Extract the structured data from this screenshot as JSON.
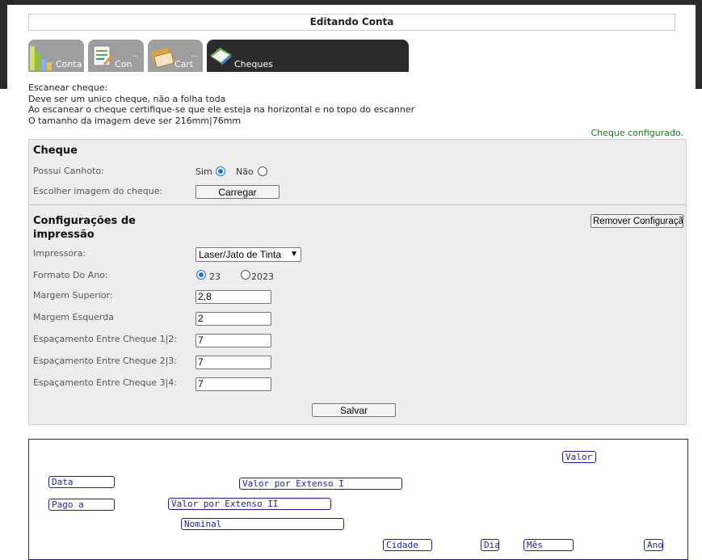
{
  "window": {
    "title": "Editando Conta"
  },
  "tabs": [
    {
      "label": "Conta",
      "more": "",
      "icon": "bar-chart-icon"
    },
    {
      "label": "Con",
      "more": "...",
      "icon": "document-icon"
    },
    {
      "label": "Cart",
      "more": "...",
      "icon": "card-icon"
    },
    {
      "label": "Cheques",
      "more": "",
      "icon": "book-icon",
      "active": true
    }
  ],
  "instructions": [
    "Escanear cheque:",
    "Deve ser um unico cheque, não a folha toda",
    "Ao escanear o cheque certifique-se que ele esteja na horizontal e no topo do escanner",
    "O tamanho da imagem deve ser 216mm|76mm"
  ],
  "status": "Cheque configurado.",
  "cheque": {
    "heading": "Cheque",
    "canhoto_label": "Possui Canhoto:",
    "sim": "Sim",
    "nao": "Não",
    "canhoto_value": "Sim",
    "imagem_label": "Escolher imagem do cheque:",
    "carregar": "Carregar"
  },
  "impressao": {
    "heading_line1": "Configurações de",
    "heading_line2": "impressão",
    "remover": "Remover Configuração",
    "impressora_label": "Impressora:",
    "impressora_value": "Laser/Jato de Tinta",
    "formato_label": "Formato Do Ano:",
    "formato_opt1": "23",
    "formato_opt2": "2023",
    "formato_value": "23",
    "margem_superior_label": "Margem Superior:",
    "margem_superior": "2,8",
    "margem_esquerda_label": "Margem Esquerda",
    "margem_esquerda": "2",
    "esp12_label": "Espaçamento Entre Cheque 1|2:",
    "esp12": "7",
    "esp23_label": "Espaçamento Entre Cheque 2|3:",
    "esp23": "7",
    "esp34_label": "Espaçamento Entre Cheque 3|4:",
    "esp34": "7",
    "salvar": "Salvar"
  },
  "preview_fields": {
    "valor": "Valor",
    "data": "Data",
    "extenso1": "Valor por Extenso I",
    "pago_a": "Pago a",
    "extenso2": "Valor por Extenso II",
    "nominal": "Nominal",
    "cidade": "Cidade",
    "dia": "Dia",
    "mes": "Mês",
    "ano": "Ano"
  },
  "colors": {
    "accent": "#1f1f9e",
    "status": "#1a7a1a",
    "tab_active": "#2b2b2b",
    "tab_inactive": "#9e9e9e"
  }
}
